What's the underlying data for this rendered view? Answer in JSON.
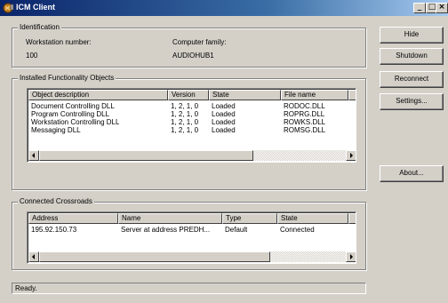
{
  "window": {
    "title": "ICM Client",
    "caption_buttons": [
      "_",
      "□",
      "×"
    ]
  },
  "identification": {
    "legend": "Identification",
    "workstation_label": "Workstation number:",
    "workstation_value": "100",
    "family_label": "Computer family:",
    "family_value": "AUDIOHUB1"
  },
  "functionality": {
    "legend": "Installed Functionality Objects",
    "columns": [
      "Object description",
      "Version",
      "State",
      "File name"
    ],
    "rows": [
      [
        "Document Controlling DLL",
        "1, 2, 1, 0",
        "Loaded",
        "RODOC.DLL"
      ],
      [
        "Program Controlling DLL",
        "1, 2, 1, 0",
        "Loaded",
        "ROPRG.DLL"
      ],
      [
        "Workstation Controlling DLL",
        "1, 2, 1, 0",
        "Loaded",
        "ROWKS.DLL"
      ],
      [
        "Messaging DLL",
        "1, 2, 1, 0",
        "Loaded",
        "ROMSG.DLL"
      ]
    ]
  },
  "crossroads": {
    "legend": "Connected Crossroads",
    "columns": [
      "Address",
      "Name",
      "Type",
      "State"
    ],
    "rows": [
      [
        "195.92.150.73",
        "Server at address PREDH...",
        "Default",
        "Connected"
      ]
    ]
  },
  "buttons": {
    "hide": "Hide",
    "shutdown": "Shutdown",
    "reconnect": "Reconnect",
    "settings": "Settings...",
    "about": "About..."
  },
  "status": "Ready."
}
